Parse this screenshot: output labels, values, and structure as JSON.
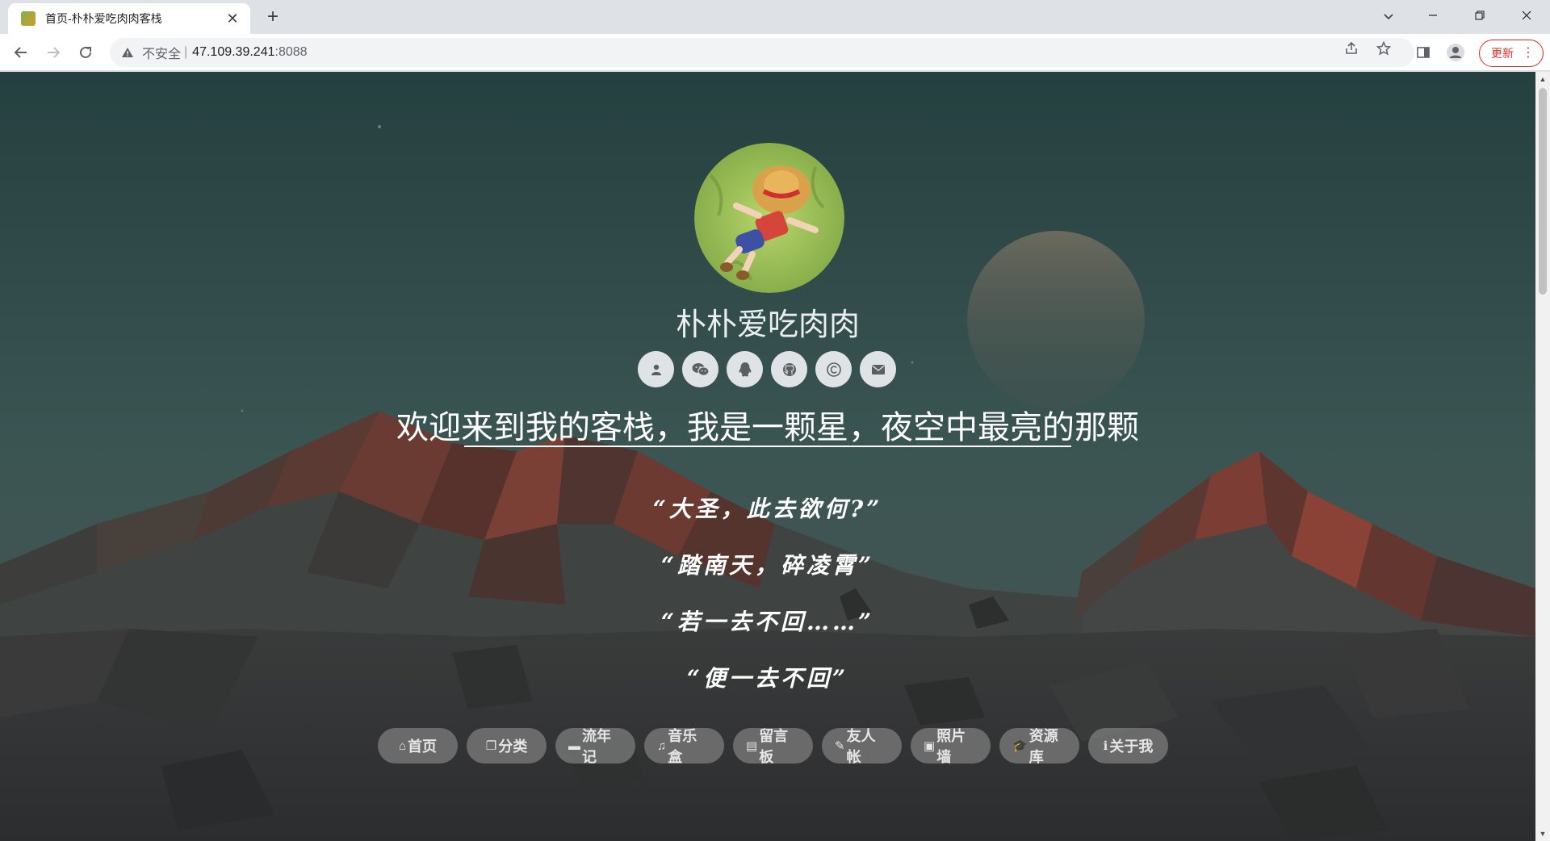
{
  "browser": {
    "tab_title": "首页-朴朴爱吃肉肉客栈",
    "tab_close": "✕",
    "new_tab": "+",
    "security_label": "不安全",
    "separator": "|",
    "url_host": "47.109.39.241",
    "url_port": ":8088",
    "update_label": "更新"
  },
  "site": {
    "name": "朴朴爱吃肉肉",
    "welcome": "欢迎来到我的客栈，我是一颗星，夜空中最亮的那颗",
    "poem": [
      "“大圣，此去欲何?”",
      "“踏南天，碎凌霄”",
      "“若一去不回……”",
      "“便一去不回”"
    ],
    "social": [
      {
        "icon": "user-icon"
      },
      {
        "icon": "wechat-icon"
      },
      {
        "icon": "qq-icon"
      },
      {
        "icon": "github-icon"
      },
      {
        "icon": "copyright-icon"
      },
      {
        "icon": "mail-icon"
      }
    ],
    "menu": [
      {
        "label": "首页",
        "icon": "home-icon"
      },
      {
        "label": "分类",
        "icon": "copy-icon"
      },
      {
        "label": "流年记",
        "icon": "laptop-icon"
      },
      {
        "label": "音乐盒",
        "icon": "music-icon"
      },
      {
        "label": "留言板",
        "icon": "note-icon"
      },
      {
        "label": "友人帐",
        "icon": "pencil-icon"
      },
      {
        "label": "照片墙",
        "icon": "image-icon"
      },
      {
        "label": "资源库",
        "icon": "graduation-cap-icon"
      },
      {
        "label": "关于我",
        "icon": "info-icon"
      }
    ]
  },
  "colors": {
    "sky": "#2f4646",
    "moon": "#5a5c52",
    "mountain_red": "#7a3b34",
    "text": "#ffffff",
    "button_bg": "#8c8c8c",
    "update_red": "#d93025"
  }
}
